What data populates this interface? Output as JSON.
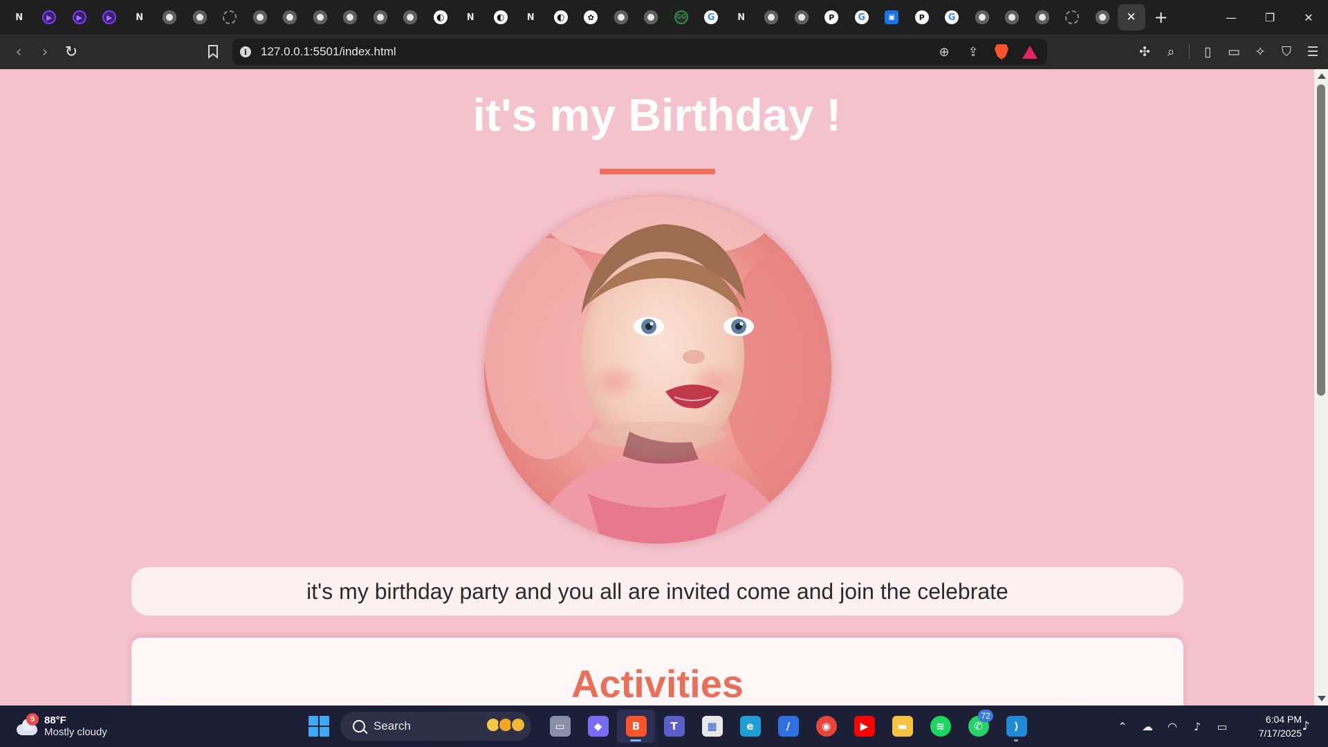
{
  "browser": {
    "tabs": [
      {
        "icon": "notion-icon",
        "glyph": "N"
      },
      {
        "icon": "purple-arrow-icon",
        "glyph": "▶"
      },
      {
        "icon": "purple-arrow-icon",
        "glyph": "▶"
      },
      {
        "icon": "purple-arrow-icon",
        "glyph": "▶"
      },
      {
        "icon": "notion-icon",
        "glyph": "N"
      },
      {
        "icon": "globe-icon",
        "glyph": ""
      },
      {
        "icon": "globe-icon",
        "glyph": ""
      },
      {
        "icon": "loading-icon",
        "glyph": ""
      },
      {
        "icon": "globe-icon",
        "glyph": ""
      },
      {
        "icon": "globe-icon",
        "glyph": ""
      },
      {
        "icon": "globe-icon",
        "glyph": ""
      },
      {
        "icon": "globe-icon",
        "glyph": ""
      },
      {
        "icon": "globe-icon",
        "glyph": ""
      },
      {
        "icon": "globe-icon",
        "glyph": ""
      },
      {
        "icon": "github-icon",
        "glyph": "◐"
      },
      {
        "icon": "notion-icon",
        "glyph": "N"
      },
      {
        "icon": "github-icon",
        "glyph": "◐"
      },
      {
        "icon": "notion-icon",
        "glyph": "N"
      },
      {
        "icon": "github-icon",
        "glyph": "◐"
      },
      {
        "icon": "openai-icon",
        "glyph": "✿"
      },
      {
        "icon": "globe-icon",
        "glyph": ""
      },
      {
        "icon": "globe-icon",
        "glyph": ""
      },
      {
        "icon": "geeksforgeeks-icon",
        "glyph": "GG"
      },
      {
        "icon": "google-icon",
        "glyph": "G"
      },
      {
        "icon": "notion-icon",
        "glyph": "N"
      },
      {
        "icon": "globe-icon",
        "glyph": ""
      },
      {
        "icon": "globe-icon",
        "glyph": ""
      },
      {
        "icon": "perplexity-icon",
        "glyph": "P"
      },
      {
        "icon": "google-icon",
        "glyph": "G"
      },
      {
        "icon": "blue-square-icon",
        "glyph": "▣"
      },
      {
        "icon": "perplexity-icon",
        "glyph": "P"
      },
      {
        "icon": "google-icon",
        "glyph": "G"
      },
      {
        "icon": "globe-icon",
        "glyph": ""
      },
      {
        "icon": "globe-icon",
        "glyph": ""
      },
      {
        "icon": "globe-icon",
        "glyph": ""
      },
      {
        "icon": "loading-icon",
        "glyph": ""
      },
      {
        "icon": "globe-icon",
        "glyph": ""
      }
    ],
    "active_tab_close": "✕",
    "new_tab": "+",
    "window_controls": {
      "minimize": "—",
      "restore": "❐",
      "close": "✕"
    },
    "nav": {
      "back": "‹",
      "forward": "›",
      "reload": "↻"
    },
    "address": "127.0.0.1:5501/index.html",
    "info_glyph": "i"
  },
  "page": {
    "title": "it's my Birthday !",
    "invite": "it's my birthday party and you all are invited come and join the celebrate",
    "activities_title": "Activities",
    "colors": {
      "background": "#f4c2cc",
      "accent": "#ec6f57",
      "activities": "#e7705b"
    }
  },
  "taskbar": {
    "weather": {
      "temp": "88°F",
      "condition": "Mostly cloudy",
      "badge": "5"
    },
    "search_label": "Search",
    "apps": [
      {
        "name": "task-view-icon",
        "glyph": "▭"
      },
      {
        "name": "copilot-icon",
        "glyph": "◆"
      },
      {
        "name": "brave-browser-icon",
        "glyph": "B",
        "active": true
      },
      {
        "name": "teams-icon",
        "glyph": "T"
      },
      {
        "name": "microsoft-store-icon",
        "glyph": "▦"
      },
      {
        "name": "edge-icon",
        "glyph": "e"
      },
      {
        "name": "whiteboard-icon",
        "glyph": "/"
      },
      {
        "name": "chrome-icon",
        "glyph": "◉"
      },
      {
        "name": "youtube-icon",
        "glyph": "▶"
      },
      {
        "name": "file-explorer-icon",
        "glyph": "▬"
      },
      {
        "name": "spotify-icon",
        "glyph": "≋"
      },
      {
        "name": "whatsapp-icon",
        "glyph": "✆",
        "badge": "72"
      },
      {
        "name": "vscode-icon",
        "glyph": "⟩",
        "running": true
      }
    ],
    "time": "6:04 PM",
    "date": "7/17/2025"
  }
}
